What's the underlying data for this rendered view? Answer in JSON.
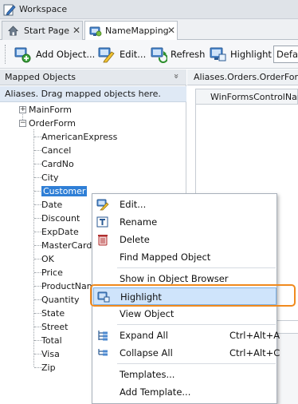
{
  "titlebar": {
    "title": "Workspace",
    "icon": "pencil-doc-icon"
  },
  "tabs": [
    {
      "label": "Start Page",
      "icon": "home-icon",
      "close": "✕",
      "active": false
    },
    {
      "label": "NameMapping",
      "icon": "namemapping-icon",
      "close": "✕",
      "active": true
    }
  ],
  "toolbar": {
    "add_object": "Add Object...",
    "edit": "Edit...",
    "refresh": "Refresh",
    "highlight": "Highlight",
    "default_select": "Defau"
  },
  "left_panel": {
    "header": "Mapped Objects",
    "collapse_icon": "»",
    "hint": "Aliases. Drag mapped objects here.",
    "tree": {
      "root_items": [
        {
          "label": "MainForm",
          "expander": "+"
        },
        {
          "label": "OrderForm",
          "expander": "−"
        }
      ],
      "children": [
        "AmericanExpress",
        "Cancel",
        "CardNo",
        "City",
        "Customer",
        "Date",
        "Discount",
        "ExpDate",
        "MasterCard",
        "OK",
        "Price",
        "ProductName",
        "Quantity",
        "State",
        "Street",
        "Total",
        "Visa",
        "Zip"
      ],
      "selected": "Customer"
    }
  },
  "right_panel": {
    "header": "Aliases.Orders.OrderForm",
    "column": "WinFormsControlName"
  },
  "context_menu": {
    "items": [
      {
        "label": "Edit...",
        "icon": "edit-icon",
        "shortcut": ""
      },
      {
        "label": "Rename",
        "icon": "rename-icon",
        "shortcut": ""
      },
      {
        "label": "Delete",
        "icon": "delete-icon",
        "shortcut": ""
      },
      {
        "label": "Find Mapped Object",
        "icon": "",
        "shortcut": ""
      },
      {
        "label": "Show in Object Browser",
        "icon": "",
        "shortcut": ""
      },
      {
        "label": "Highlight",
        "icon": "highlight-icon",
        "shortcut": ""
      },
      {
        "label": "View Object",
        "icon": "",
        "shortcut": ""
      },
      {
        "label": "Expand All",
        "icon": "expand-all-icon",
        "shortcut": "Ctrl+Alt+A"
      },
      {
        "label": "Collapse All",
        "icon": "collapse-all-icon",
        "shortcut": "Ctrl+Alt+C"
      },
      {
        "label": "Templates...",
        "icon": "",
        "shortcut": ""
      },
      {
        "label": "Add Template...",
        "icon": "",
        "shortcut": ""
      }
    ],
    "highlighted": "Highlight"
  },
  "colors": {
    "selection": "#2f7fd6",
    "menu_hover": "#cfe4fb",
    "callout_outline": "#f08a1e"
  }
}
